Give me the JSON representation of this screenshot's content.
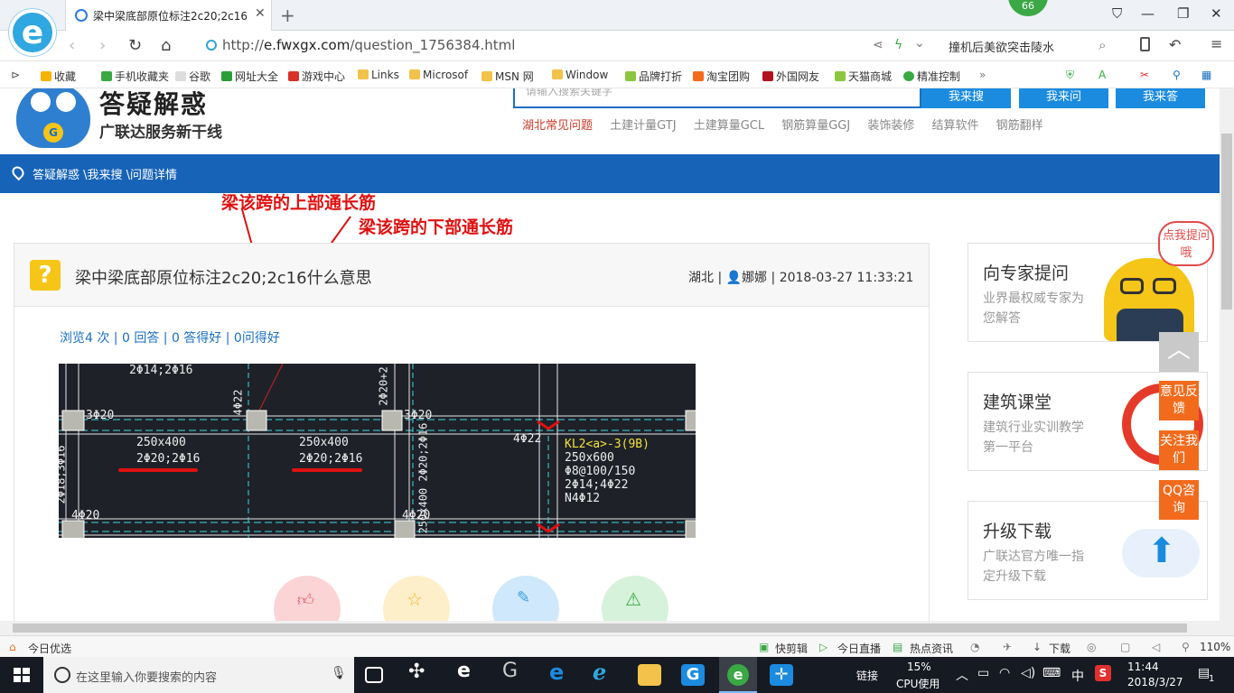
{
  "browser": {
    "tab_title": "梁中梁底部原位标注2c20;2c16什",
    "url_prefix": "http://",
    "url_domain": "e.fwxgx.com",
    "url_path": "/question_1756384.html",
    "badge": "66",
    "hot_search": "撞机后美欲突击陵水"
  },
  "bookmarks": [
    "收藏",
    "手机收藏夹",
    "谷歌",
    "网址大全",
    "游戏中心",
    "Links",
    "Microsof",
    "MSN 网",
    "Window",
    "品牌打折",
    "淘宝团购",
    "外国网友",
    "天猫商城",
    "精准控制"
  ],
  "site": {
    "logo_title": "答疑解惑",
    "logo_sub": "广联达服务新干线",
    "search_placeholder": "请输入搜索关键字",
    "btn_search": "我来搜",
    "btn_ask": "我来问",
    "btn_answer": "我来答",
    "categories": [
      "湖北常见问题",
      "土建计量GTJ",
      "土建算量GCL",
      "钢筋算量GGJ",
      "装饰装修",
      "结算软件",
      "钢筋翻样"
    ],
    "breadcrumb": "答疑解惑 \\我来搜 \\问题详情"
  },
  "annotations": {
    "top": "梁该跨的上部通长筋",
    "bottom": "梁该跨的下部通长筋"
  },
  "question": {
    "title": "梁中梁底部原位标注2c20;2c16什么意思",
    "region": "湖北",
    "user": "娜娜",
    "time": "2018-03-27 11:33:21",
    "stats": "浏览4 次 | 0 回答 | 0 答得好 | 0问得好",
    "cad": {
      "t1": "2Φ14;2Φ16",
      "t2": "3Φ20",
      "t3": "4Φ22",
      "t4": "2Φ20+2",
      "t5": "3Φ20",
      "b1_size": "250x400",
      "b1_bar": "2Φ20;2Φ16",
      "b2_size": "250x400",
      "b2_bar": "2Φ20;2Φ16",
      "left_v": "2Φ18;3Φ16",
      "mid_v": "250x400 2Φ20;2Φ16",
      "k_4022": "4Φ22",
      "kl_name": "KL2<a>-3(9B)",
      "kl_size": "250x600",
      "kl_stir": "Φ8@100/150",
      "kl_bars": "2Φ14;4Φ22",
      "kl_n": "N4Φ12",
      "bl": "4Φ20",
      "bm": "4Φ20"
    }
  },
  "sidebar": {
    "expert_title": "向专家提问",
    "expert_desc": "业界最权威专家为您解答",
    "bubble": "点我提问哦",
    "course_title": "建筑课堂",
    "course_desc": "建筑行业实训教学第一平台",
    "upgrade_title": "升级下载",
    "upgrade_desc": "广联达官方唯一指定升级下载",
    "float_feedback": "意见反馈",
    "float_follow": "关注我们",
    "float_qq": "QQ咨询"
  },
  "statusbar": {
    "left": "今日优选",
    "items": [
      "快剪辑",
      "今日直播",
      "热点资讯",
      "下载"
    ],
    "zoom": "110%"
  },
  "taskbar": {
    "search_placeholder": "在这里输入你要搜索的内容",
    "link": "链接",
    "cpu": "15%",
    "cpu_label": "CPU使用",
    "ime": "中",
    "time": "11:44",
    "date": "2018/3/27",
    "notif": "1"
  }
}
